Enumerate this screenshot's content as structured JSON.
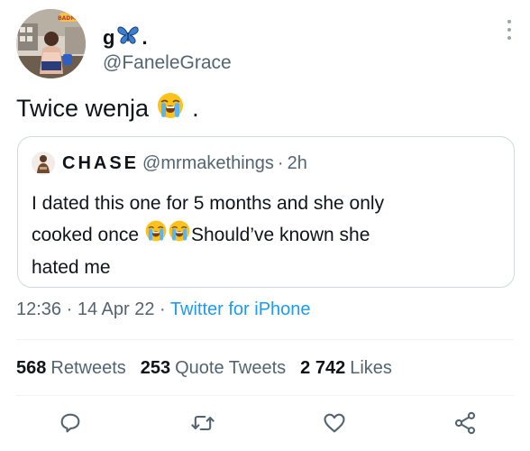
{
  "tweet": {
    "display_name": "g",
    "display_name_suffix": ".",
    "handle": "@FaneleGrace",
    "avatar_text": "BADMAN",
    "text": "Twice wenja",
    "text_suffix": "."
  },
  "quote": {
    "name": "CHASE",
    "handle": "@mrmakethings",
    "separator": "·",
    "time": "2h",
    "line1": "I dated this one for 5 months and she only",
    "line2_a": "cooked once",
    "line2_b": "Should’ve known she",
    "line3": "hated me"
  },
  "meta": {
    "time": "12:36",
    "separator1": "·",
    "date": "14 Apr 22",
    "separator2": "·",
    "source": "Twitter for iPhone"
  },
  "stats": {
    "retweets_count": "568",
    "retweets_label": "Retweets",
    "quotes_count": "253",
    "quotes_label": "Quote Tweets",
    "likes_count": "2 742",
    "likes_label": "Likes"
  },
  "icons": {
    "reply": "reply-icon",
    "retweet": "retweet-icon",
    "like": "heart-icon",
    "share": "share-icon",
    "more": "more-icon",
    "butterfly": "butterfly-emoji-icon",
    "crying": "loudly-crying-face-emoji-icon"
  },
  "colors": {
    "link": "#1d9bf0",
    "secondary_text": "#536471",
    "butterfly": "#3b7fd4",
    "emoji_face": "#fcc21b"
  }
}
